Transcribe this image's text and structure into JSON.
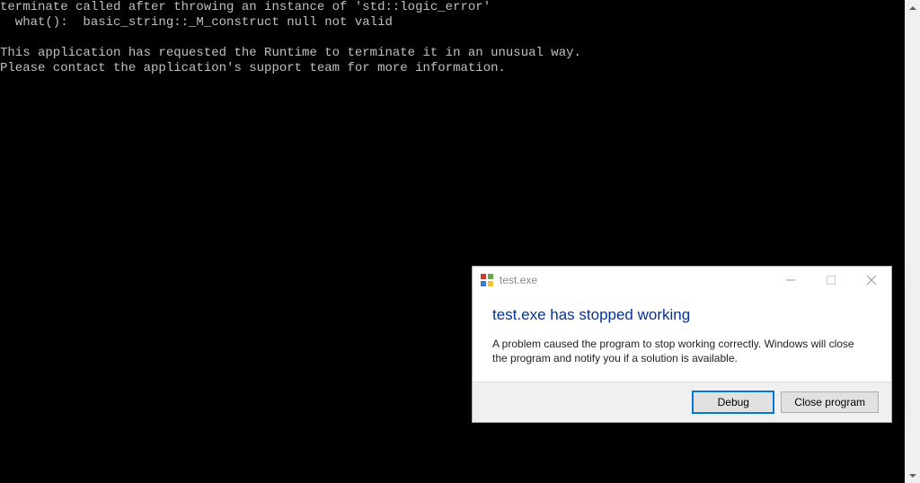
{
  "terminal": {
    "line1": "terminate called after throwing an instance of 'std::logic_error'",
    "line2": "  what():  basic_string::_M_construct null not valid",
    "line3": "",
    "line4": "This application has requested the Runtime to terminate it in an unusual way.",
    "line5": "Please contact the application's support team for more information."
  },
  "dialog": {
    "title": "test.exe",
    "heading": "test.exe has stopped working",
    "message": "A problem caused the program to stop working correctly. Windows will close the program and notify you if a solution is available.",
    "buttons": {
      "debug": "Debug",
      "close": "Close program"
    }
  }
}
